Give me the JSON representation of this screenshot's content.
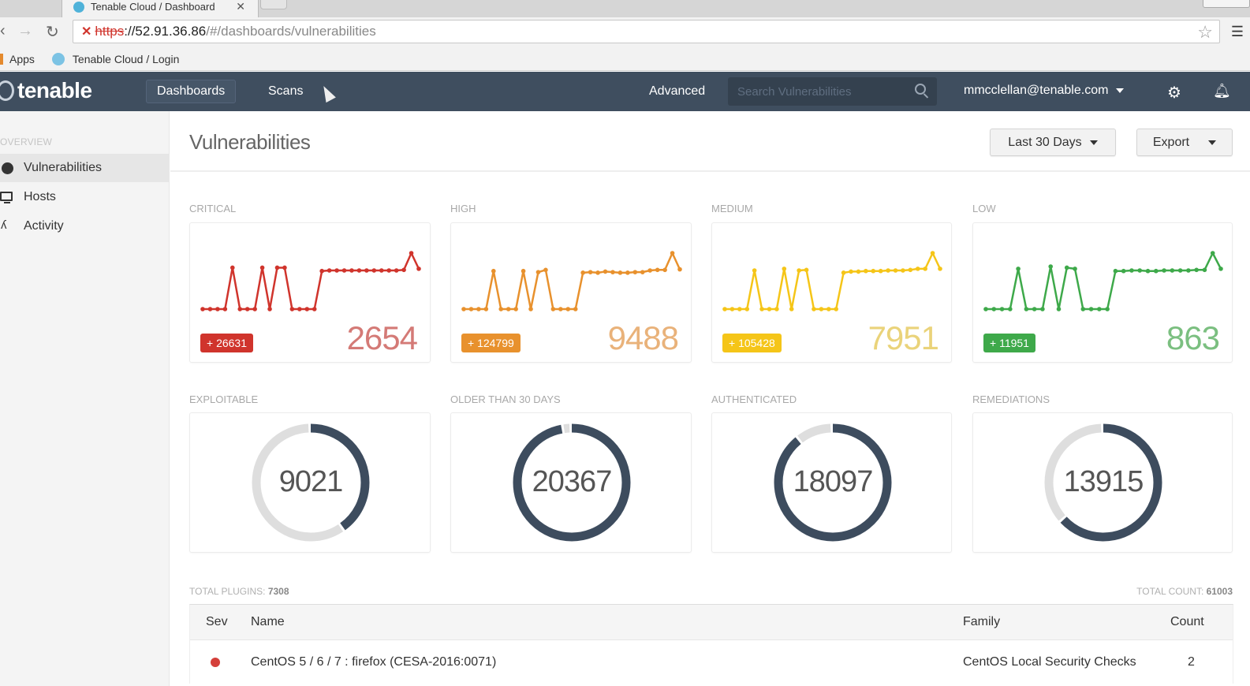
{
  "browser": {
    "tab_title": "Tenable Cloud / Dashboard",
    "url_scheme": "https",
    "url_host": "://52.91.36.86",
    "url_path": "/#/dashboards/vulnerabilities",
    "bookmarks": [
      {
        "label": "Apps",
        "icon": "apps-icon"
      },
      {
        "label": "Tenable Cloud / Login",
        "icon": "tenable-favicon-icon"
      }
    ]
  },
  "header": {
    "logo": "tenable",
    "nav": [
      {
        "label": "Dashboards",
        "active": true
      },
      {
        "label": "Scans",
        "active": false
      }
    ],
    "advanced_label": "Advanced",
    "search_placeholder": "Search Vulnerabilities",
    "user_email": "mmcclellan@tenable.com",
    "settings_icon": "gear-icon",
    "notifications_icon": "bell-icon"
  },
  "sidebar": {
    "section_title": "OVERVIEW",
    "items": [
      {
        "label": "Vulnerabilities",
        "icon": "globe-icon",
        "active": true
      },
      {
        "label": "Hosts",
        "icon": "monitor-icon",
        "active": false
      },
      {
        "label": "Activity",
        "icon": "pulse-icon",
        "active": false
      }
    ]
  },
  "main": {
    "title": "Vulnerabilities",
    "date_range": "Last 30 Days",
    "export_label": "Export",
    "severity_cards": [
      {
        "label": "CRITICAL",
        "delta": "+ 26631",
        "value": "2654",
        "color": "#d0342c",
        "num_color": "#d47a76"
      },
      {
        "label": "HIGH",
        "delta": "+ 124799",
        "value": "9488",
        "color": "#e8912d",
        "num_color": "#e9b27a"
      },
      {
        "label": "MEDIUM",
        "delta": "+ 105428",
        "value": "7951",
        "color": "#f5c518",
        "num_color": "#ead37a"
      },
      {
        "label": "LOW",
        "delta": "+ 11951",
        "value": "863",
        "color": "#3ea94a",
        "num_color": "#7bbf80"
      }
    ],
    "donut_cards": [
      {
        "label": "EXPLOITABLE",
        "value": "9021",
        "fraction": 0.4
      },
      {
        "label": "OLDER THAN 30 DAYS",
        "value": "20367",
        "fraction": 0.97
      },
      {
        "label": "AUTHENTICATED",
        "value": "18097",
        "fraction": 0.89
      },
      {
        "label": "REMEDIATIONS",
        "value": "13915",
        "fraction": 0.63
      }
    ],
    "donut_colors": {
      "fill": "#3d4c5e",
      "track": "#dedede"
    },
    "total_plugins_label": "TOTAL PLUGINS:",
    "total_plugins": "7308",
    "total_count_label": "TOTAL COUNT:",
    "total_count": "61003",
    "table": {
      "columns": [
        "Sev",
        "Name",
        "Family",
        "Count"
      ],
      "rows": [
        {
          "sev": "critical",
          "sev_color": "#d43f3a",
          "name": "CentOS 5 / 6 / 7 : firefox (CESA-2016:0071)",
          "family": "CentOS Local Security Checks",
          "count": "2"
        }
      ]
    }
  },
  "chart_data": [
    {
      "type": "line",
      "title": "CRITICAL",
      "note": "normalized trend (30 days)",
      "values": [
        0,
        0,
        0,
        0,
        0.74,
        0,
        0,
        0,
        0.74,
        0,
        0.74,
        0.74,
        0,
        0,
        0,
        0,
        0.68,
        0.69,
        0.69,
        0.69,
        0.69,
        0.69,
        0.69,
        0.69,
        0.69,
        0.69,
        0.69,
        0.7,
        1.0,
        0.72
      ]
    },
    {
      "type": "line",
      "title": "HIGH",
      "note": "normalized trend (30 days)",
      "values": [
        0,
        0,
        0,
        0,
        0.68,
        0,
        0,
        0,
        0.68,
        0,
        0.66,
        0.7,
        0,
        0,
        0,
        0,
        0.65,
        0.66,
        0.65,
        0.67,
        0.66,
        0.65,
        0.65,
        0.66,
        0.66,
        0.69,
        0.7,
        0.7,
        1.0,
        0.71
      ]
    },
    {
      "type": "line",
      "title": "MEDIUM",
      "note": "normalized trend (30 days)",
      "values": [
        0,
        0,
        0,
        0,
        0.69,
        0,
        0,
        0,
        0.72,
        0,
        0.69,
        0.7,
        0,
        0,
        0,
        0,
        0.65,
        0.67,
        0.67,
        0.68,
        0.68,
        0.68,
        0.69,
        0.69,
        0.69,
        0.7,
        0.72,
        0.72,
        1.0,
        0.72
      ]
    },
    {
      "type": "line",
      "title": "LOW",
      "note": "normalized trend (30 days)",
      "values": [
        0,
        0,
        0,
        0,
        0.72,
        0,
        0,
        0,
        0.76,
        0,
        0.74,
        0.72,
        0,
        0,
        0,
        0,
        0.68,
        0.68,
        0.69,
        0.69,
        0.68,
        0.68,
        0.69,
        0.69,
        0.69,
        0.69,
        0.7,
        0.7,
        1.0,
        0.72
      ]
    }
  ]
}
